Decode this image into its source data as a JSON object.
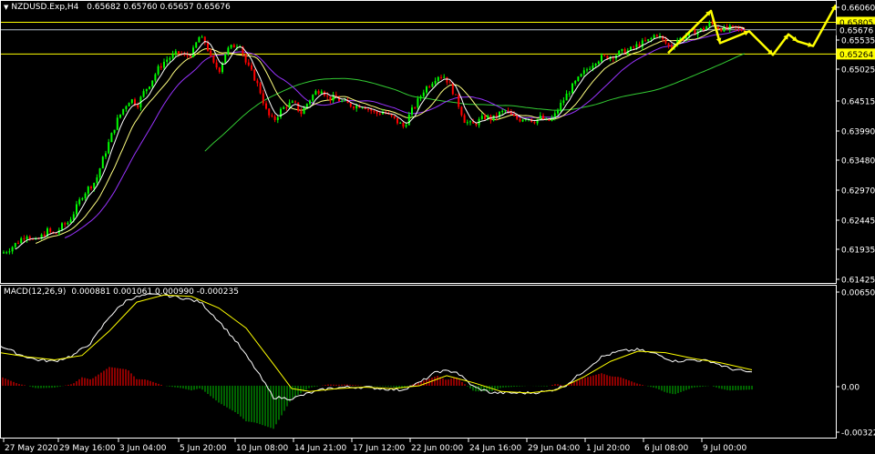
{
  "header": {
    "symbol": "NZDUSD.Exp,H4",
    "open": "0.65682",
    "high": "0.65760",
    "low": "0.65657",
    "close": "0.65676"
  },
  "macd_header": {
    "label": "MACD(12,26,9)",
    "values": "0.000881 0.001061 0.000990 -0.000235"
  },
  "colors": {
    "background": "#000000",
    "bull_candle": "#00ff00",
    "bear_candle": "#ff0000",
    "ma_fast": "#ffffff",
    "ma_medium": "#ffff80",
    "ma_purple": "#9933ff",
    "ma_slow": "#33cc33",
    "hline": "#ffff00",
    "price_line": "#b4c0cc",
    "forecast_arrow": "#ffff00",
    "macd_main": "#ffffff",
    "macd_signal": "#ffff00",
    "hist_pos": "#b00000",
    "hist_neg": "#007a00"
  },
  "chart_data": [
    {
      "type": "candlestick",
      "symbol": "NZDUSD.Exp",
      "timeframe": "H4",
      "ylim": [
        0.61425,
        0.6606
      ],
      "y_ticks": [
        "0.66060",
        "0.65535",
        "0.65025",
        "0.64515",
        "0.63990",
        "0.63480",
        "0.62970",
        "0.62445",
        "0.61935",
        "0.61425"
      ],
      "x_ticks": [
        "27 May 2020",
        "29 May 16:00",
        "3 Jun 04:00",
        "5 Jun 20:00",
        "10 Jun 08:00",
        "14 Jun 21:00",
        "17 Jun 12:00",
        "22 Jun 00:00",
        "24 Jun 16:00",
        "29 Jun 04:00",
        "1 Jul 20:00",
        "6 Jul 08:00",
        "9 Jul 00:00"
      ],
      "price_labels": [
        {
          "value": 0.65805,
          "label": "0.65805",
          "style": "highlight"
        },
        {
          "value": 0.65676,
          "label": "0.65676",
          "style": "current"
        },
        {
          "value": 0.65264,
          "label": "0.65264",
          "style": "highlight"
        }
      ],
      "horizontal_lines": [
        0.65805,
        0.65676,
        0.65264
      ],
      "close_path": [
        [
          0,
          0.6185
        ],
        [
          8,
          0.6192
        ],
        [
          15,
          0.62
        ],
        [
          22,
          0.621
        ],
        [
          30,
          0.622
        ],
        [
          38,
          0.6205
        ],
        [
          45,
          0.6215
        ],
        [
          52,
          0.6225
        ],
        [
          60,
          0.6218
        ],
        [
          67,
          0.6232
        ],
        [
          75,
          0.624
        ],
        [
          83,
          0.6262
        ],
        [
          90,
          0.6285
        ],
        [
          98,
          0.63
        ],
        [
          105,
          0.631
        ],
        [
          113,
          0.6348
        ],
        [
          120,
          0.6378
        ],
        [
          128,
          0.6412
        ],
        [
          136,
          0.6435
        ],
        [
          143,
          0.645
        ],
        [
          151,
          0.644
        ],
        [
          158,
          0.6462
        ],
        [
          166,
          0.648
        ],
        [
          173,
          0.65
        ],
        [
          181,
          0.6515
        ],
        [
          188,
          0.6522
        ],
        [
          196,
          0.6528
        ],
        [
          203,
          0.6522
        ],
        [
          211,
          0.6528
        ],
        [
          218,
          0.6555
        ],
        [
          226,
          0.6545
        ],
        [
          233,
          0.651
        ],
        [
          241,
          0.65
        ],
        [
          248,
          0.6532
        ],
        [
          256,
          0.654
        ],
        [
          263,
          0.6545
        ],
        [
          270,
          0.651
        ],
        [
          278,
          0.649
        ],
        [
          285,
          0.6465
        ],
        [
          293,
          0.6425
        ],
        [
          300,
          0.6412
        ],
        [
          308,
          0.643
        ],
        [
          315,
          0.644
        ],
        [
          323,
          0.6442
        ],
        [
          330,
          0.6425
        ],
        [
          338,
          0.6445
        ],
        [
          345,
          0.646
        ],
        [
          353,
          0.6468
        ],
        [
          360,
          0.645
        ],
        [
          368,
          0.6452
        ],
        [
          375,
          0.6445
        ],
        [
          383,
          0.644
        ],
        [
          390,
          0.6438
        ],
        [
          398,
          0.644
        ],
        [
          405,
          0.6432
        ],
        [
          413,
          0.6425
        ],
        [
          420,
          0.6428
        ],
        [
          428,
          0.642
        ],
        [
          435,
          0.6412
        ],
        [
          443,
          0.6402
        ],
        [
          450,
          0.6425
        ],
        [
          458,
          0.6445
        ],
        [
          465,
          0.6465
        ],
        [
          473,
          0.6478
        ],
        [
          480,
          0.649
        ],
        [
          488,
          0.6488
        ],
        [
          495,
          0.647
        ],
        [
          503,
          0.644
        ],
        [
          510,
          0.6412
        ],
        [
          518,
          0.6405
        ],
        [
          525,
          0.6412
        ],
        [
          533,
          0.642
        ],
        [
          540,
          0.6415
        ],
        [
          548,
          0.6425
        ],
        [
          555,
          0.643
        ],
        [
          563,
          0.6418
        ],
        [
          570,
          0.6415
        ],
        [
          578,
          0.642
        ],
        [
          585,
          0.6412
        ],
        [
          593,
          0.6418
        ],
        [
          600,
          0.641
        ],
        [
          608,
          0.642
        ],
        [
          615,
          0.644
        ],
        [
          623,
          0.646
        ],
        [
          630,
          0.6475
        ],
        [
          638,
          0.649
        ],
        [
          645,
          0.6502
        ],
        [
          653,
          0.6515
        ],
        [
          660,
          0.652
        ],
        [
          668,
          0.6522
        ],
        [
          675,
          0.6525
        ],
        [
          683,
          0.653
        ],
        [
          690,
          0.6532
        ],
        [
          698,
          0.654
        ],
        [
          705,
          0.6545
        ],
        [
          713,
          0.655
        ],
        [
          720,
          0.6562
        ],
        [
          728,
          0.6548
        ],
        [
          735,
          0.6538
        ],
        [
          743,
          0.655
        ],
        [
          750,
          0.6555
        ],
        [
          758,
          0.6562
        ],
        [
          765,
          0.6565
        ],
        [
          773,
          0.657
        ],
        [
          780,
          0.658
        ],
        [
          788,
          0.6572
        ],
        [
          795,
          0.6568
        ],
        [
          803,
          0.657
        ],
        [
          810,
          0.6568
        ],
        [
          818,
          0.6567
        ]
      ],
      "series": [
        {
          "name": "MA fast",
          "color": "#ffffff"
        },
        {
          "name": "MA medium",
          "color": "#ffff80"
        },
        {
          "name": "MA purple",
          "color": "#9933ff"
        },
        {
          "name": "MA slow",
          "color": "#33cc33"
        }
      ],
      "forecast_arrow_path": [
        [
          733,
          0.6528
        ],
        [
          780,
          0.66
        ],
        [
          790,
          0.6545
        ],
        [
          822,
          0.6565
        ],
        [
          848,
          0.6525
        ],
        [
          865,
          0.656
        ],
        [
          875,
          0.6548
        ],
        [
          892,
          0.654
        ],
        [
          917,
          0.661
        ]
      ]
    },
    {
      "type": "macd",
      "ylim": [
        -0.003224,
        0.006504
      ],
      "y_ticks": [
        "0.006504",
        "0.00",
        "-0.003224"
      ],
      "main": [
        [
          0,
          0.0028
        ],
        [
          20,
          0.0022
        ],
        [
          40,
          0.0018
        ],
        [
          60,
          0.0017
        ],
        [
          80,
          0.0021
        ],
        [
          100,
          0.003
        ],
        [
          120,
          0.0048
        ],
        [
          140,
          0.006
        ],
        [
          160,
          0.0063
        ],
        [
          180,
          0.0063
        ],
        [
          200,
          0.0061
        ],
        [
          220,
          0.0058
        ],
        [
          240,
          0.0045
        ],
        [
          260,
          0.003
        ],
        [
          280,
          0.0012
        ],
        [
          300,
          -0.0008
        ],
        [
          320,
          -0.0009
        ],
        [
          340,
          -0.0005
        ],
        [
          360,
          -0.0002
        ],
        [
          380,
          -0.0001
        ],
        [
          400,
          -0.0001
        ],
        [
          420,
          -0.0002
        ],
        [
          440,
          -0.0003
        ],
        [
          460,
          0.0002
        ],
        [
          480,
          0.001
        ],
        [
          500,
          0.001
        ],
        [
          520,
          -0.0001
        ],
        [
          540,
          -0.0005
        ],
        [
          560,
          -0.0005
        ],
        [
          580,
          -0.0005
        ],
        [
          600,
          -0.0004
        ],
        [
          620,
          0.0
        ],
        [
          640,
          0.001
        ],
        [
          660,
          0.002
        ],
        [
          680,
          0.0024
        ],
        [
          700,
          0.0025
        ],
        [
          720,
          0.0022
        ],
        [
          740,
          0.0017
        ],
        [
          760,
          0.0018
        ],
        [
          780,
          0.0017
        ],
        [
          800,
          0.0012
        ],
        [
          825,
          0.0009
        ]
      ],
      "signal": [
        [
          0,
          0.0023
        ],
        [
          30,
          0.002
        ],
        [
          60,
          0.0018
        ],
        [
          90,
          0.0021
        ],
        [
          120,
          0.0038
        ],
        [
          150,
          0.0058
        ],
        [
          180,
          0.0063
        ],
        [
          210,
          0.0062
        ],
        [
          240,
          0.0054
        ],
        [
          270,
          0.004
        ],
        [
          300,
          0.0015
        ],
        [
          320,
          -0.0002
        ],
        [
          340,
          -0.0004
        ],
        [
          370,
          -0.0002
        ],
        [
          400,
          -0.0001
        ],
        [
          430,
          -0.0002
        ],
        [
          460,
          0.0
        ],
        [
          490,
          0.0007
        ],
        [
          520,
          0.0002
        ],
        [
          550,
          -0.0004
        ],
        [
          580,
          -0.0005
        ],
        [
          610,
          -0.0003
        ],
        [
          640,
          0.0006
        ],
        [
          670,
          0.0017
        ],
        [
          700,
          0.0024
        ],
        [
          730,
          0.0023
        ],
        [
          760,
          0.0019
        ],
        [
          790,
          0.0016
        ],
        [
          825,
          0.0011
        ]
      ]
    }
  ]
}
